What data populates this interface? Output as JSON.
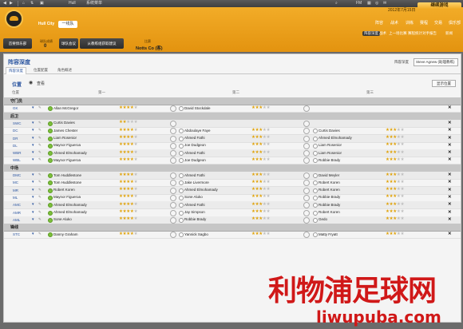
{
  "topbar": {
    "club": "Hull",
    "menu": "系统菜单",
    "fm": "FM",
    "icons": [
      "back-icon",
      "forward-icon",
      "home-icon",
      "sort-icon",
      "shirt-icon",
      "search-icon",
      "calendar-icon",
      "globe-icon",
      "mail-icon"
    ]
  },
  "header": {
    "club_name": "Hull City",
    "squad": "一线队",
    "left_btn": "首要俱乐部",
    "stat1_label": "球队成绩",
    "stat1_value": "0",
    "btn_team_meeting": "球队会议",
    "btn_next": "从教练组获取建议",
    "opp_label": "比赛",
    "opp_value": "Notts Co (客)",
    "date": "2012年7月15日",
    "continue": "继续游戏"
  },
  "nav_top": [
    "阵容",
    "战术",
    "训练",
    "赛程",
    "交易",
    "俱乐部"
  ],
  "nav_bottom": [
    "阵容深度",
    "战术",
    "上一场比赛",
    "赛程统计",
    "对手报告",
    "新闻"
  ],
  "panel": {
    "title": "阵容深度",
    "formation_label": "阵容深度",
    "formation": "Steve Agnew (助理教练)",
    "tabs": [
      "阵容深度",
      "位置配置",
      "角色概述"
    ],
    "positions_header": "位置",
    "view_label": "查看",
    "show_button": "显示位置",
    "col_pos": "位置",
    "col_first": "第一",
    "col_second": "第二",
    "col_third": "第三"
  },
  "rows": [
    {
      "type": "section",
      "label": "守门员"
    },
    {
      "type": "player",
      "pos": "GK",
      "p1": "Allan McGregor",
      "s1": 4,
      "p2": "David Stockdale",
      "s2": 3,
      "p3": "",
      "s3": 0,
      "mark": ""
    },
    {
      "type": "section",
      "label": "后卫"
    },
    {
      "type": "player",
      "pos": "SWC",
      "p1": "Curtis Davies",
      "s1": 2,
      "p2": "",
      "s2": 0,
      "p3": "",
      "s3": 0,
      "mark": ""
    },
    {
      "type": "player",
      "pos": "DC",
      "p1": "James Chester",
      "s1": 4,
      "p2": "Abdoulaye Faye",
      "s2": 3,
      "p3": "Curtis Davies",
      "s3": 3,
      "mark": ""
    },
    {
      "type": "player",
      "pos": "DR",
      "p1": "Liam Rosenior",
      "s1": 4,
      "p2": "Ahmed Fathi",
      "s2": 3,
      "p3": "Ahmed Elmohamady",
      "s3": 3,
      "mark": ""
    },
    {
      "type": "player",
      "pos": "DL",
      "p1": "Maynor Figueroa",
      "s1": 4,
      "p2": "Joe Dudgeon",
      "s2": 3,
      "p3": "Liam Rosenior",
      "s3": 3,
      "mark": ""
    },
    {
      "type": "player",
      "pos": "WBR",
      "p1": "Ahmed Elmohamady",
      "s1": 4,
      "p2": "Ahmed Fathi",
      "s2": 3,
      "p3": "Liam Rosenior",
      "s3": 3,
      "mark": ""
    },
    {
      "type": "player",
      "pos": "WBL",
      "p1": "Maynor Figueroa",
      "s1": 4,
      "p2": "Joe Dudgeon",
      "s2": 3,
      "p3": "Robbie Brady",
      "s3": 3,
      "mark": ""
    },
    {
      "type": "section",
      "label": "中场"
    },
    {
      "type": "player",
      "pos": "DMC",
      "p1": "Tom Huddlestone",
      "s1": 4,
      "p2": "Ahmed Fathi",
      "s2": 3,
      "p3": "David Meyler",
      "s3": 3,
      "mark": ""
    },
    {
      "type": "player",
      "pos": "MC",
      "p1": "Tom Huddlestone",
      "s1": 4,
      "p2": "Jake Livermore",
      "s2": 3,
      "p3": "Robert Koren",
      "s3": 3,
      "mark": ""
    },
    {
      "type": "player",
      "pos": "MR",
      "p1": "Robert Koren",
      "s1": 4,
      "p2": "Ahmed Elmohamady",
      "s2": 3,
      "p3": "Robert Koren",
      "s3": 3,
      "mark": ""
    },
    {
      "type": "player",
      "pos": "ML",
      "p1": "Maynor Figueroa",
      "s1": 4,
      "p2": "Sone Aluko",
      "s2": 3,
      "p3": "Robbie Brady",
      "s3": 3,
      "mark": ""
    },
    {
      "type": "player",
      "pos": "AMC",
      "p1": "Ahmed Elmohamady",
      "s1": 4,
      "p2": "Ahmed Fathi",
      "s2": 3,
      "p3": "Robbie Brady",
      "s3": 3,
      "mark": ""
    },
    {
      "type": "player",
      "pos": "AMR",
      "p1": "Ahmed Elmohamady",
      "s1": 4,
      "p2": "Jay Simpson",
      "s2": 3,
      "p3": "Robert Koren",
      "s3": 3,
      "mark": ""
    },
    {
      "type": "player",
      "pos": "AML",
      "p1": "Sone Aluko",
      "s1": 4,
      "p2": "Robbie Brady",
      "s2": 3,
      "p3": "Gedo",
      "s3": 3,
      "mark": ""
    },
    {
      "type": "section",
      "label": "锋线"
    },
    {
      "type": "player",
      "pos": "STC",
      "p1": "Danny Graham",
      "s1": 4,
      "p2": "Yannick Sagbo",
      "s2": 3,
      "p3": "Matty Fryatt",
      "s3": 3,
      "mark": ""
    }
  ],
  "watermark": {
    "cn": "利物浦足球网",
    "en": "liwupuba.com"
  },
  "colors": {
    "accent": "#f2ac28",
    "link": "#2b55a0",
    "star": "#e0a30b",
    "watermark": "#d01818"
  }
}
